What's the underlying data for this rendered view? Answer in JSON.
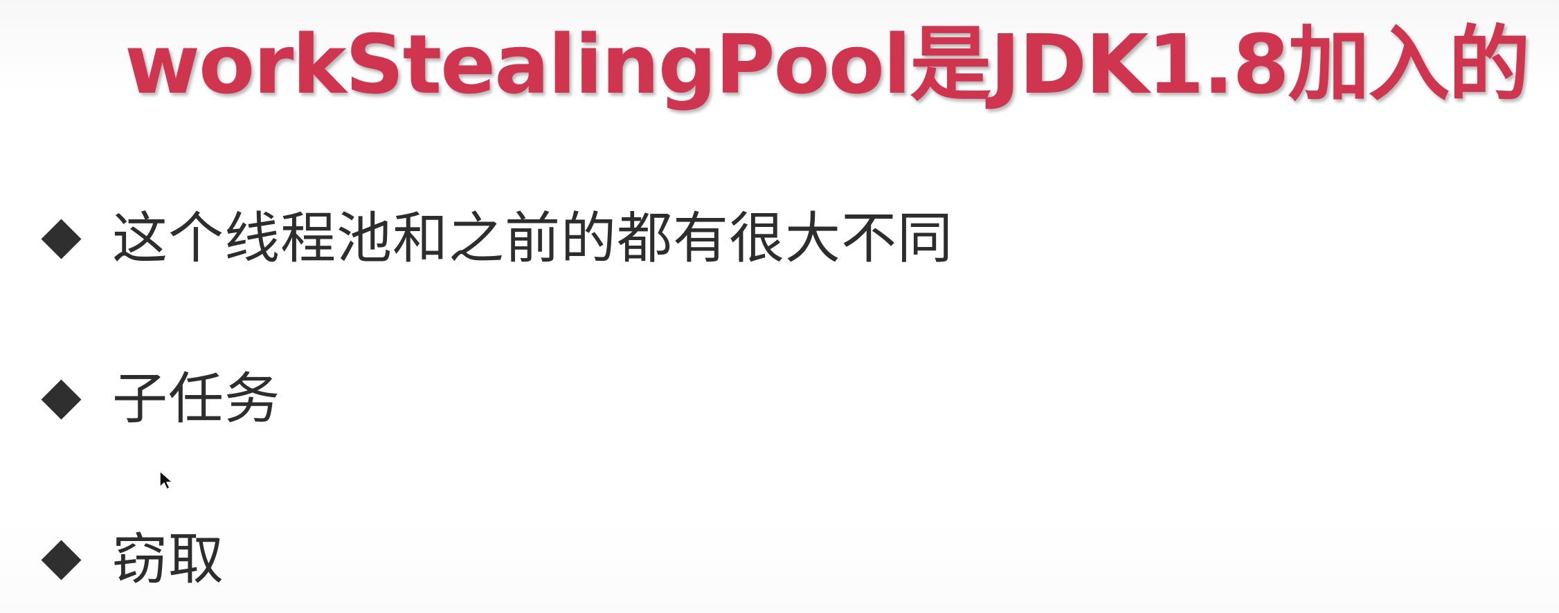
{
  "slide": {
    "title": "workStealingPool是JDK1.8加入的",
    "bullets": [
      "这个线程池和之前的都有很大不同",
      "子任务",
      "窃取"
    ]
  },
  "colors": {
    "title": "#d03550",
    "text": "#2d2d2d",
    "bullet": "#2f2f2f",
    "background": "#ffffff"
  },
  "icons": {
    "bullet": "black-diamond",
    "pointer": "mouse-pointer-icon"
  }
}
